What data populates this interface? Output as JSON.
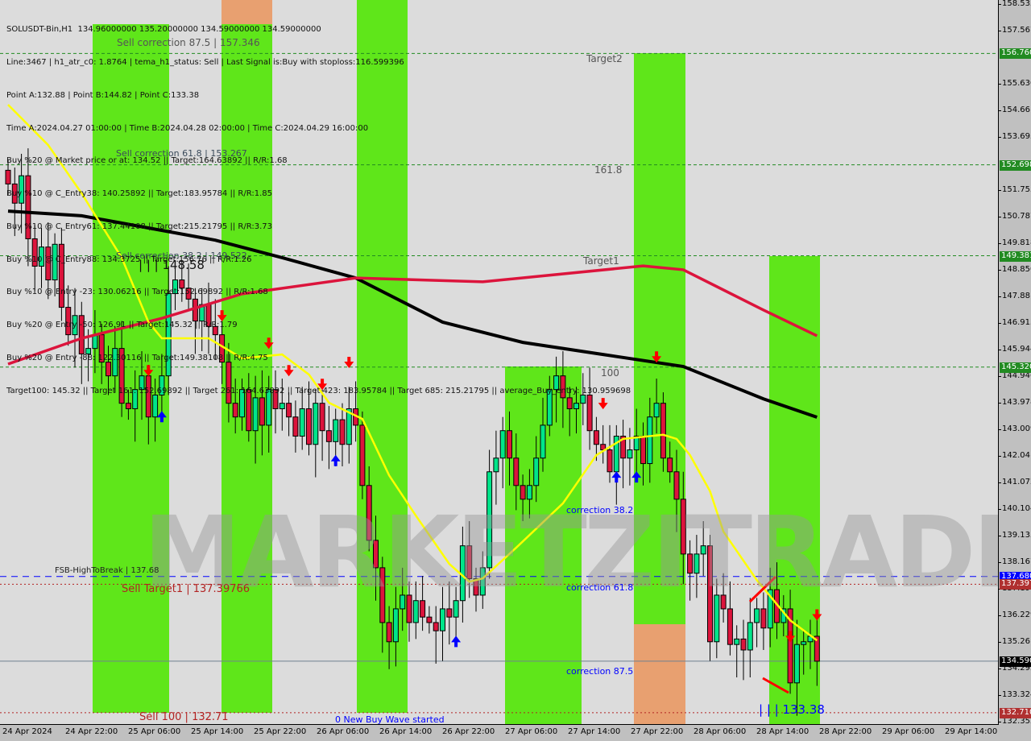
{
  "header": {
    "lines": [
      "SOLUSDT-Bin,H1  134.96000000 135.20000000 134.59000000 134.59000000",
      "Line:3467 | h1_atr_c0: 1.8764 | tema_h1_status: Sell | Last Signal is:Buy with stoploss:116.599396",
      "Point A:132.88 | Point B:144.82 | Point C:133.38",
      "Time A:2024.04.27 01:00:00 | Time B:2024.04.28 02:00:00 | Time C:2024.04.29 16:00:00",
      "Buy %20 @ Market price or at: 134.52 || Target:164.63892 || R/R:1.68",
      "Buy %10 @ C_Entry38: 140.25892 || Target:183.95784 || R/R:1.85",
      "Buy %10 @ C_Entry61: 137.44108 || Target:215.21795 || R/R:3.73",
      "Buy %10 @ C_Entry88: 134.3725 || Target:156.76 || R/R:1.26",
      "Buy %10 @ Entry -23: 130.06216 || Target:152.69892 || R/R:1.68",
      "Buy %20 @ Entry -50: 126.91 || Target:145.32 || R/R:1.79",
      "Buy %20 @ Entry -88: 122.30116 || Target:149.38108 || R/R:4.75",
      "Target100: 145.32 || Target 161: 152.69892 || Target 261: 164.63892 || Target 423: 183.95784 || Target 685: 215.21795 || average_Buy_entry: 130.959698"
    ]
  },
  "annotations": {
    "sell_corr_875": "Sell correction 87.5 | 157.346",
    "sell_corr_618": "Sell correction 61.8 | 153.267",
    "sell_corr_382": "Sell correction 38.2 | 149.522",
    "point_b_mark": "| | | 148.58",
    "target2": "Target2",
    "fib_1618": "161.8",
    "target1": "Target1",
    "fib_100": "100",
    "corr_382": "correction 38.2",
    "corr_618": "correction 61.8",
    "corr_875": "correction 87.5",
    "fsb": "FSB-HighToBreak | 137.68",
    "sell_target1": "Sell Target1 | 137.39766",
    "sell_100": "Sell 100 | 132.71",
    "new_wave": "0 New Buy Wave started",
    "point_c_mark": "| | | 133.38"
  },
  "watermark": "MARKETZITRADE",
  "colors": {
    "bull": "#00e58a",
    "bear": "#dc143c",
    "zone_green": "#5fe61a",
    "zone_orange": "#e8a070",
    "ma_slow": "#000000",
    "ma_mid": "#dc143c",
    "tema": "#ffff00",
    "level_green": "#228b22",
    "level_blue": "#0000ff",
    "level_red": "#b22222"
  },
  "chart_data": {
    "type": "candlestick",
    "symbol": "SOLUSDT-Bin",
    "timeframe": "H1",
    "ylim": [
      132.355,
      158.535
    ],
    "y_ticks": [
      "158.535",
      "157.567",
      "155.630",
      "154.661",
      "153.693",
      "151.755",
      "150.787",
      "149.818",
      "148.850",
      "147.881",
      "146.913",
      "145.944",
      "144.946",
      "143.978",
      "143.009",
      "142.041",
      "141.072",
      "140.104",
      "139.135",
      "138.167",
      "137.198",
      "136.229",
      "135.261",
      "134.292",
      "133.324",
      "132.355"
    ],
    "x_ticks": [
      "24 Apr 2024",
      "24 Apr 22:00",
      "25 Apr 06:00",
      "25 Apr 14:00",
      "25 Apr 22:00",
      "26 Apr 06:00",
      "26 Apr 14:00",
      "26 Apr 22:00",
      "27 Apr 06:00",
      "27 Apr 14:00",
      "27 Apr 22:00",
      "28 Apr 06:00",
      "28 Apr 14:00",
      "28 Apr 22:00",
      "29 Apr 06:00",
      "29 Apr 14:00"
    ],
    "close": [
      152.0,
      151.3,
      152.3,
      150.0,
      149.0,
      149.7,
      148.5,
      149.8,
      147.5,
      146.5,
      147.2,
      145.8,
      146.0,
      146.5,
      145.5,
      145.0,
      146.0,
      144.0,
      143.8,
      144.5,
      145.0,
      143.5,
      144.3,
      145.0,
      148.0,
      148.5,
      148.2,
      147.8,
      147.0,
      147.6,
      146.8,
      146.5,
      145.5,
      144.0,
      143.5,
      144.5,
      143.0,
      144.2,
      143.2,
      144.5,
      143.8,
      144.0,
      143.5,
      142.8,
      143.8,
      142.5,
      144.0,
      143.0,
      142.6,
      143.4,
      142.5,
      143.8,
      143.2,
      141.0,
      139.0,
      138.0,
      136.0,
      135.3,
      136.5,
      137.0,
      136.0,
      136.8,
      136.2,
      136.0,
      135.7,
      136.5,
      136.2,
      136.8,
      138.8,
      137.6,
      137.0,
      138.0,
      141.5,
      142.0,
      143.0,
      142.0,
      141.0,
      140.5,
      141.0,
      142.0,
      143.2,
      144.5,
      145.0,
      144.2,
      143.8,
      144.0,
      144.3,
      143.0,
      142.5,
      142.3,
      141.5,
      142.8,
      142.0,
      142.3,
      142.8,
      141.8,
      143.5,
      144.0,
      142.0,
      141.5,
      140.5,
      138.5,
      137.8,
      138.5,
      138.8,
      135.3,
      137.0,
      136.5,
      135.2,
      135.4,
      135.0,
      136.0,
      136.5,
      135.8,
      137.2,
      136.0,
      136.5,
      133.8,
      135.2,
      135.3,
      135.5,
      134.59
    ],
    "series": [
      {
        "key": "ma_slow",
        "points": [
          [
            0,
            151.01
          ],
          [
            11,
            150.84
          ],
          [
            31,
            149.95
          ],
          [
            41,
            149.31
          ],
          [
            52,
            148.57
          ],
          [
            65,
            146.96
          ],
          [
            77,
            146.22
          ],
          [
            89,
            145.78
          ],
          [
            101,
            145.34
          ],
          [
            113,
            144.16
          ],
          [
            121,
            143.49
          ]
        ]
      },
      {
        "key": "ma_mid",
        "points": [
          [
            0,
            145.43
          ],
          [
            11,
            146.37
          ],
          [
            23,
            147.1
          ],
          [
            35,
            147.99
          ],
          [
            52,
            148.57
          ],
          [
            71,
            148.43
          ],
          [
            95,
            149.01
          ],
          [
            101,
            148.87
          ],
          [
            113,
            147.4
          ],
          [
            121,
            146.46
          ]
        ]
      },
      {
        "key": "tema",
        "points": [
          [
            0,
            154.89
          ],
          [
            6,
            153.42
          ],
          [
            11,
            151.66
          ],
          [
            17,
            149.31
          ],
          [
            21,
            146.96
          ],
          [
            23,
            146.37
          ],
          [
            30,
            146.37
          ],
          [
            35,
            145.64
          ],
          [
            41,
            145.78
          ],
          [
            45,
            145.05
          ],
          [
            48,
            144.02
          ],
          [
            53,
            143.43
          ],
          [
            57,
            141.37
          ],
          [
            61,
            139.9
          ],
          [
            66,
            138.14
          ],
          [
            69,
            137.49
          ],
          [
            71,
            137.61
          ],
          [
            76,
            138.73
          ],
          [
            83,
            140.35
          ],
          [
            88,
            142.11
          ],
          [
            92,
            142.7
          ],
          [
            98,
            142.85
          ],
          [
            100,
            142.7
          ],
          [
            102,
            142.11
          ],
          [
            105,
            140.79
          ],
          [
            107,
            139.32
          ],
          [
            112,
            137.55
          ],
          [
            117,
            136.08
          ],
          [
            121,
            135.35
          ]
        ]
      }
    ],
    "levels": [
      {
        "price": "156.760",
        "kind": "green"
      },
      {
        "price": "152.698",
        "kind": "green"
      },
      {
        "price": "149.381",
        "kind": "green"
      },
      {
        "price": "145.320",
        "kind": "green"
      },
      {
        "price": "137.680",
        "kind": "blue"
      },
      {
        "price": "137.397",
        "kind": "red"
      },
      {
        "price": "134.590",
        "kind": "last"
      },
      {
        "price": "132.710",
        "kind": "red"
      }
    ],
    "signals": [
      {
        "bar": 21,
        "type": "sell"
      },
      {
        "bar": 32,
        "type": "sell"
      },
      {
        "bar": 39,
        "type": "sell"
      },
      {
        "bar": 42,
        "type": "sell"
      },
      {
        "bar": 47,
        "type": "sell"
      },
      {
        "bar": 51,
        "type": "sell"
      },
      {
        "bar": 89,
        "type": "sell"
      },
      {
        "bar": 97,
        "type": "sell"
      },
      {
        "bar": 117,
        "type": "sell"
      },
      {
        "bar": 121,
        "type": "sell"
      },
      {
        "bar": 23,
        "type": "buy"
      },
      {
        "bar": 49,
        "type": "buy"
      },
      {
        "bar": 67,
        "type": "buy"
      },
      {
        "bar": 91,
        "type": "buy"
      },
      {
        "bar": 94,
        "type": "buy"
      }
    ]
  }
}
